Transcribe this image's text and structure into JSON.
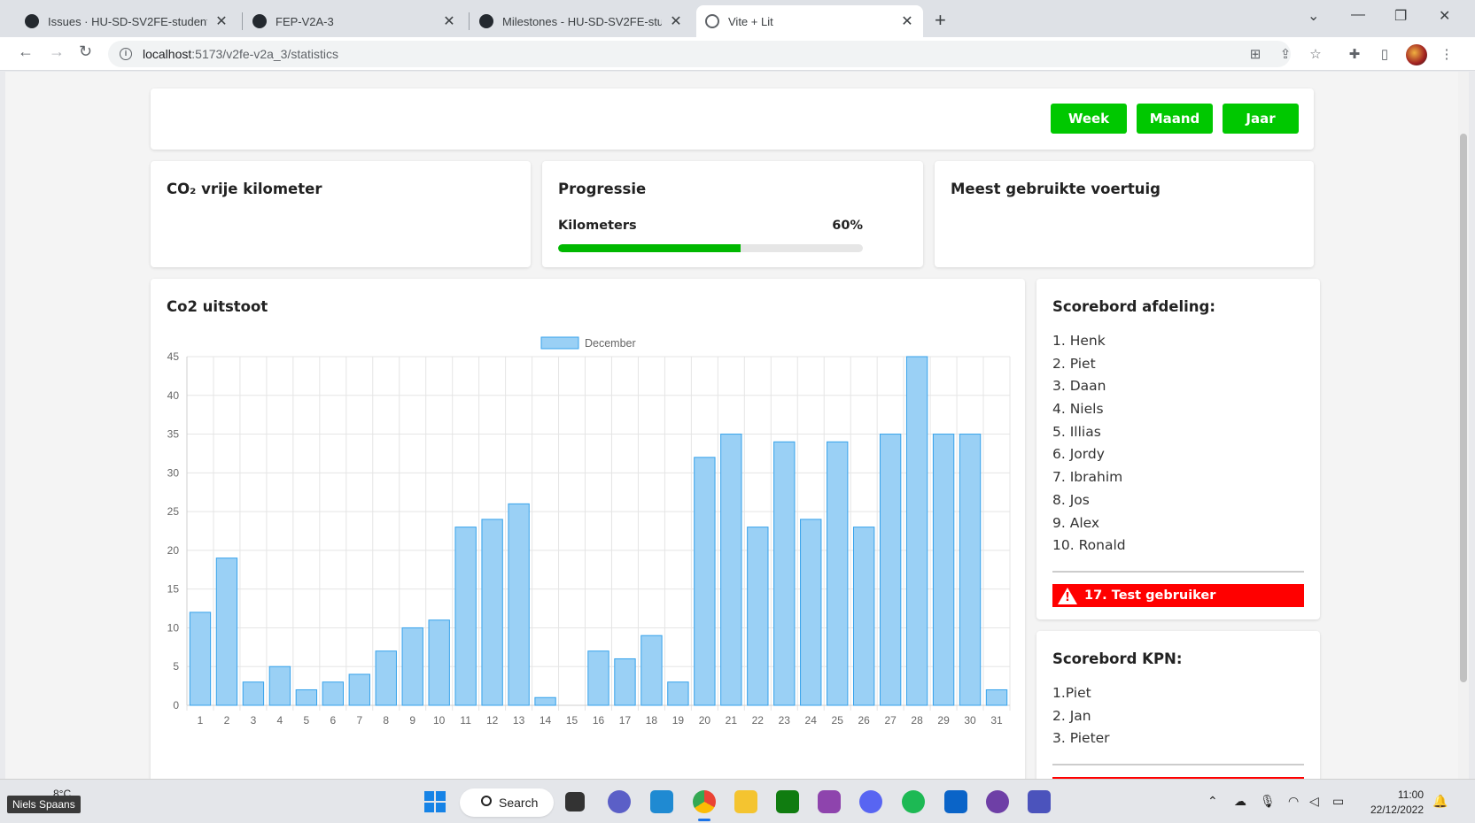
{
  "browser": {
    "tabs": [
      {
        "title": "Issues · HU-SD-SV2FE-studenten",
        "icon": "github-icon"
      },
      {
        "title": "FEP-V2A-3",
        "icon": "github-icon"
      },
      {
        "title": "Milestones - HU-SD-SV2FE-stude",
        "icon": "github-icon"
      },
      {
        "title": "Vite + Lit",
        "icon": "globe-icon"
      }
    ],
    "active_tab_index": 3,
    "url_host": "localhost",
    "url_path": ":5173/v2fe-v2a_3/statistics"
  },
  "period_buttons": {
    "week": "Week",
    "month": "Maand",
    "year": "Jaar"
  },
  "cards": {
    "co2_free": {
      "title": "CO₂ vrije kilometer"
    },
    "progress": {
      "title": "Progressie",
      "label": "Kilometers",
      "percent_text": "60%",
      "percent": 60
    },
    "vehicle": {
      "title": "Meest gebruikte voertuig"
    },
    "co2_chart": {
      "title": "Co2 uitstoot"
    },
    "scoreboard_dept": {
      "title": "Scorebord afdeling:",
      "items": [
        "1. Henk",
        "2. Piet",
        "3. Daan",
        "4. Niels",
        "5. Illias",
        "6. Jordy",
        "7. Ibrahim",
        "8. Jos",
        "9. Alex",
        "10. Ronald"
      ],
      "current_user": "17. Test gebruiker"
    },
    "scoreboard_kpn": {
      "title": "Scorebord KPN:",
      "items": [
        "1.Piet",
        "2. Jan",
        "3. Pieter"
      ]
    }
  },
  "chart_data": {
    "type": "bar",
    "title": "",
    "legend": "December",
    "legend_position": "top",
    "categories": [
      "1",
      "2",
      "3",
      "4",
      "5",
      "6",
      "7",
      "8",
      "9",
      "10",
      "11",
      "12",
      "13",
      "14",
      "15",
      "16",
      "17",
      "18",
      "19",
      "20",
      "21",
      "22",
      "23",
      "24",
      "25",
      "26",
      "27",
      "28",
      "29",
      "30",
      "31"
    ],
    "series": [
      {
        "name": "December",
        "values": [
          12,
          19,
          3,
          5,
          2,
          3,
          4,
          7,
          10,
          11,
          23,
          24,
          26,
          1,
          0,
          7,
          6,
          9,
          3,
          32,
          35,
          23,
          34,
          24,
          34,
          23,
          35,
          45,
          35,
          35,
          2
        ]
      }
    ],
    "ylim": [
      0,
      45
    ],
    "yticks": [
      0,
      5,
      10,
      15,
      20,
      25,
      30,
      35,
      40,
      45
    ],
    "grid": true,
    "bar_color": "#9ad0f5",
    "bar_border": "#36a2eb"
  },
  "taskbar": {
    "search": "Search",
    "weather": "8°C",
    "user": "Niels Spaans",
    "time": "11:00",
    "date": "22/12/2022",
    "apps": [
      "windows-icon",
      "search",
      "task-view-icon",
      "teams-meet-icon",
      "vscode-icon",
      "chrome-icon",
      "file-explorer-icon",
      "xbox-icon",
      "app-icon",
      "discord-icon",
      "spotify-icon",
      "outlook-icon",
      "github-desktop-icon",
      "teams-icon"
    ]
  }
}
